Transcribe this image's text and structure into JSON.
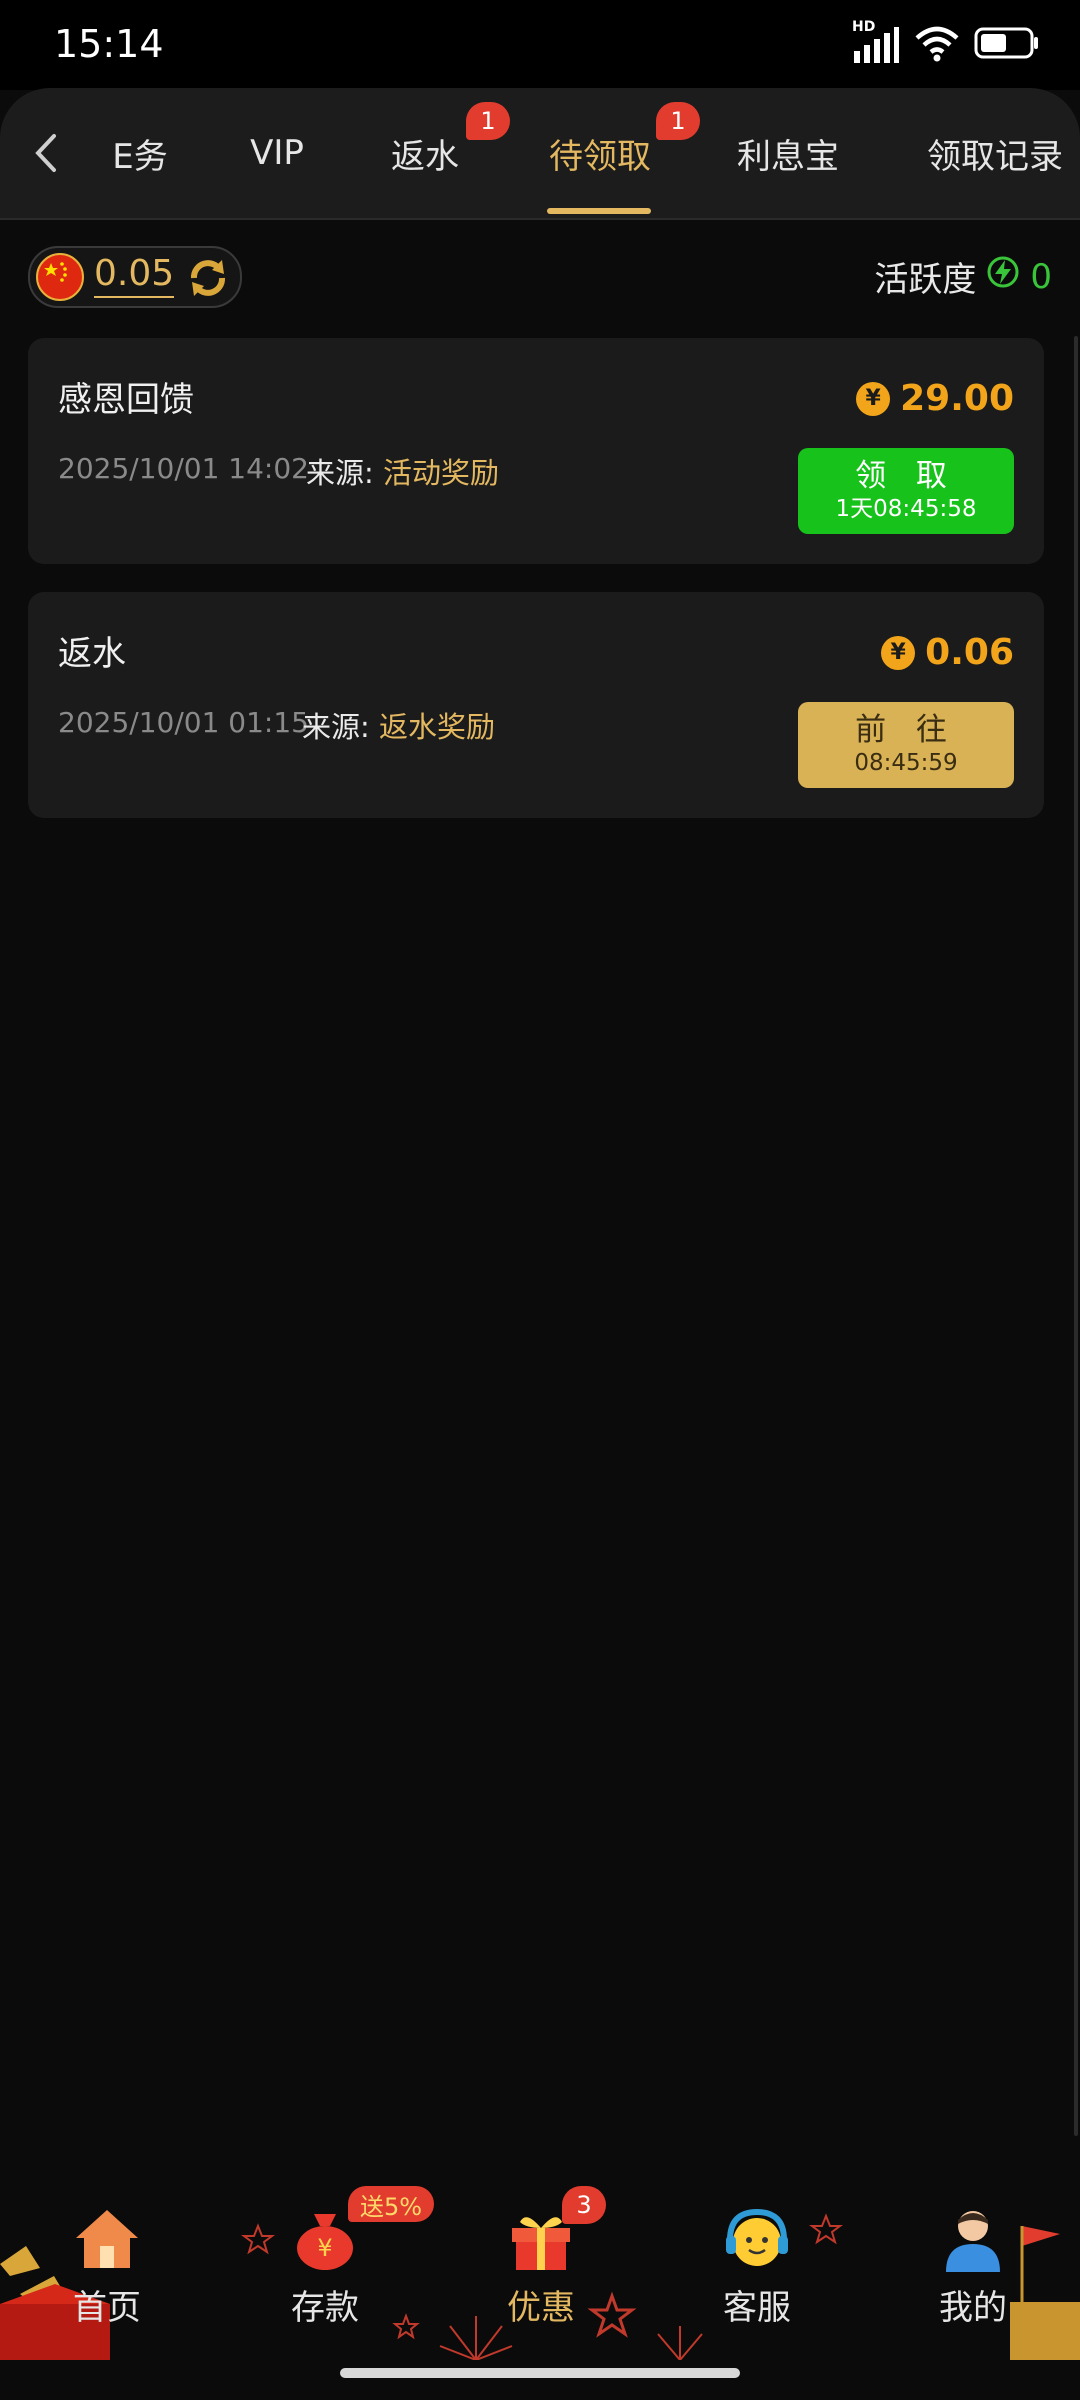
{
  "status": {
    "time": "15:14",
    "network": "HD",
    "battery_level": 0.55
  },
  "tabs": [
    {
      "label": "E务",
      "active": false
    },
    {
      "label": "VIP",
      "active": false
    },
    {
      "label": "返水",
      "active": false,
      "badge": "1"
    },
    {
      "label": "待领取",
      "active": true,
      "badge": "1"
    },
    {
      "label": "利息宝",
      "active": false
    },
    {
      "label": "领取记录",
      "active": false
    }
  ],
  "balance": {
    "value": "0.05"
  },
  "activity": {
    "label": "活跃度",
    "value": "0"
  },
  "cards": [
    {
      "title": "感恩回馈",
      "amount": "29.00",
      "date": "2025/10/01 14:02",
      "source_label": "来源:",
      "source_value": "活动奖励",
      "button_label": "领 取",
      "button_sub": "1天08:45:58",
      "button_style": "green"
    },
    {
      "title": "返水",
      "amount": "0.06",
      "date": "2025/10/01 01:15",
      "source_label": "来源:",
      "source_value": "返水奖励",
      "button_label": "前 往",
      "button_sub": "08:45:59",
      "button_style": "gold"
    }
  ],
  "currency_symbol": "¥",
  "bottom_nav": [
    {
      "label": "首页",
      "icon": "house-icon"
    },
    {
      "label": "存款",
      "icon": "money-bag-icon",
      "badge": "送5%"
    },
    {
      "label": "优惠",
      "icon": "gift-icon",
      "badge": "3"
    },
    {
      "label": "客服",
      "icon": "headset-icon"
    },
    {
      "label": "我的",
      "icon": "user-icon"
    }
  ],
  "colors": {
    "accent_gold": "#e3b860",
    "amount_orange": "#f2a51a",
    "claim_green": "#17c21a",
    "badge_red": "#e23c2e",
    "activity_green": "#39c43a"
  }
}
